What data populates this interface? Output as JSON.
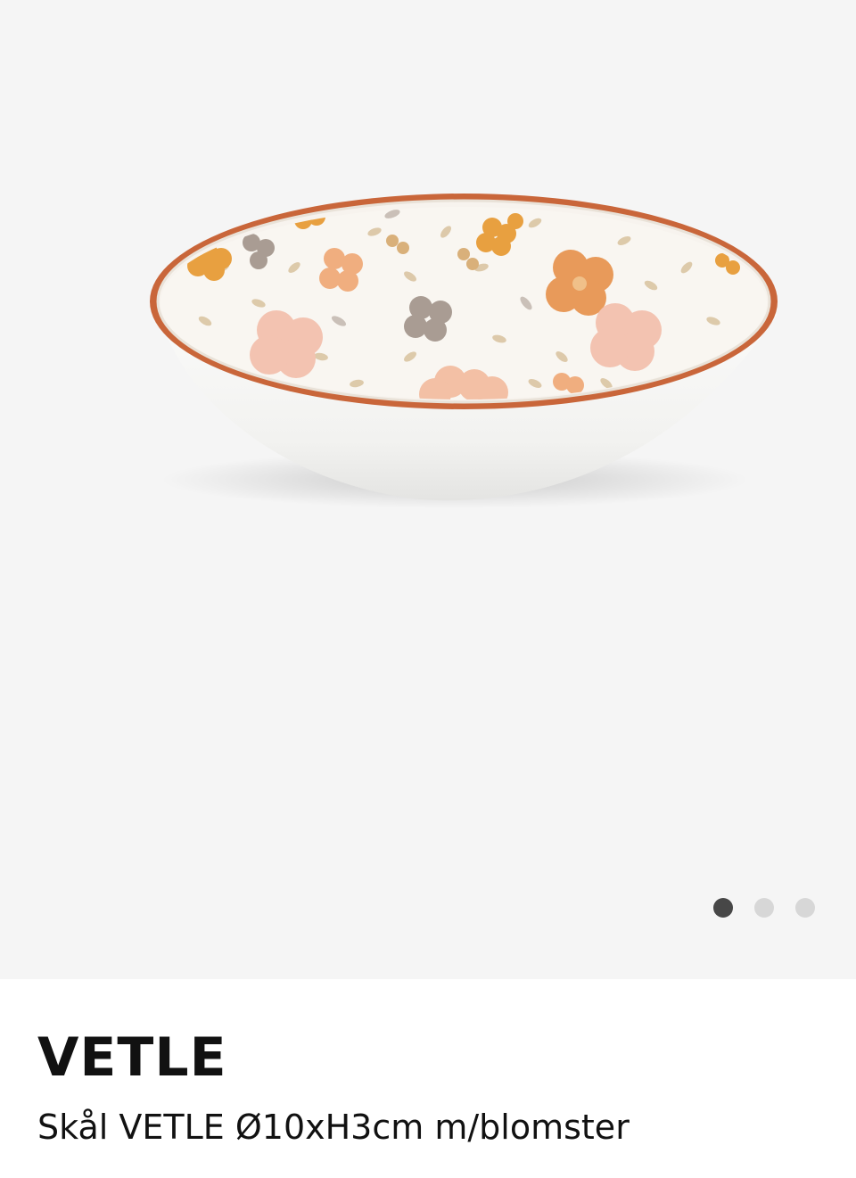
{
  "gallery": {
    "image_alt": "Skål VETLE Ø10xH3cm m/blomster",
    "slide_count": 3,
    "active_slide": 1
  },
  "product": {
    "title": "VETLE",
    "description": "Skål VETLE Ø10xH3cm m/blomster"
  },
  "colors": {
    "gallery_background": "#f5f5f5",
    "rim": "#c9663a",
    "dot_active": "#474747",
    "dot_inactive": "#d7d7d7"
  }
}
